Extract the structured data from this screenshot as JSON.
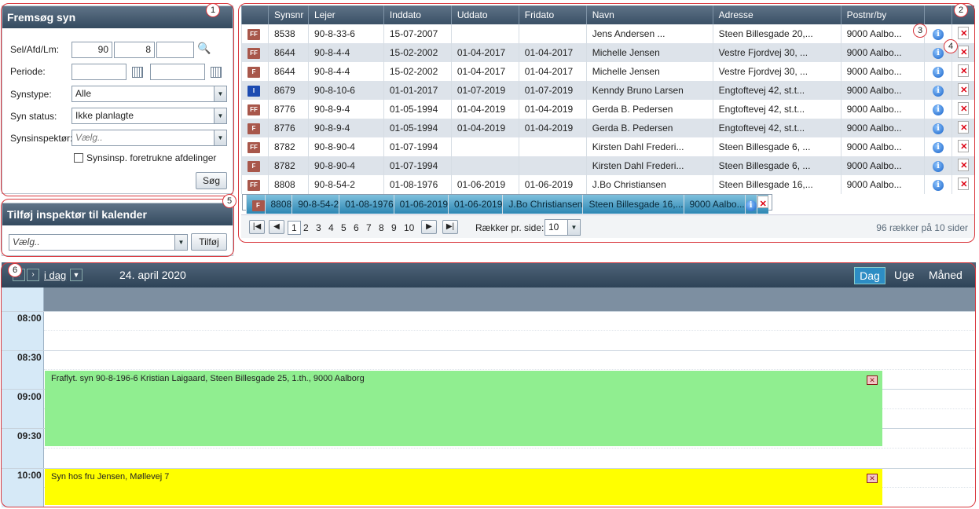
{
  "search": {
    "title": "Fremsøg syn",
    "sel_label": "Sel/Afd/Lm:",
    "sel_value": "90",
    "afd_value": "8",
    "lm_value": "",
    "periode_label": "Periode:",
    "synstype_label": "Synstype:",
    "synstype_value": "Alle",
    "status_label": "Syn status:",
    "status_value": "Ikke planlagte",
    "inspektor_label": "Synsinspektør:",
    "inspektor_placeholder": "Vælg..",
    "checkbox_label": "Synsinsp. foretrukne afdelinger",
    "search_button": "Søg"
  },
  "add": {
    "title": "Tilføj inspektør til kalender",
    "placeholder": "Vælg..",
    "button": "Tilføj"
  },
  "grid": {
    "columns": [
      "",
      "Synsnr",
      "Lejer",
      "Inddato",
      "Uddato",
      "Fridato",
      "Navn",
      "Adresse",
      "Postnr/by",
      "",
      ""
    ],
    "rows": [
      {
        "tag": "FF",
        "synsnr": "8538",
        "lejer": "90-8-33-6",
        "inddato": "15-07-2007",
        "uddato": "",
        "fridato": "",
        "navn": "Jens Andersen ...",
        "adresse": "Steen Billesgade 20,...",
        "postnr": "9000 Aalbo..."
      },
      {
        "tag": "FF",
        "synsnr": "8644",
        "lejer": "90-8-4-4",
        "inddato": "15-02-2002",
        "uddato": "01-04-2017",
        "fridato": "01-04-2017",
        "navn": "Michelle Jensen",
        "adresse": "Vestre Fjordvej 30, ...",
        "postnr": "9000 Aalbo..."
      },
      {
        "tag": "F",
        "synsnr": "8644",
        "lejer": "90-8-4-4",
        "inddato": "15-02-2002",
        "uddato": "01-04-2017",
        "fridato": "01-04-2017",
        "navn": "Michelle Jensen",
        "adresse": "Vestre Fjordvej 30, ...",
        "postnr": "9000 Aalbo..."
      },
      {
        "tag": "I",
        "synsnr": "8679",
        "lejer": "90-8-10-6",
        "inddato": "01-01-2017",
        "uddato": "01-07-2019",
        "fridato": "01-07-2019",
        "navn": "Kenndy Bruno Larsen",
        "adresse": "Engtoftevej 42, st.t...",
        "postnr": "9000 Aalbo..."
      },
      {
        "tag": "FF",
        "synsnr": "8776",
        "lejer": "90-8-9-4",
        "inddato": "01-05-1994",
        "uddato": "01-04-2019",
        "fridato": "01-04-2019",
        "navn": "Gerda B. Pedersen",
        "adresse": "Engtoftevej 42, st.t...",
        "postnr": "9000 Aalbo..."
      },
      {
        "tag": "F",
        "synsnr": "8776",
        "lejer": "90-8-9-4",
        "inddato": "01-05-1994",
        "uddato": "01-04-2019",
        "fridato": "01-04-2019",
        "navn": "Gerda B. Pedersen",
        "adresse": "Engtoftevej 42, st.t...",
        "postnr": "9000 Aalbo..."
      },
      {
        "tag": "FF",
        "synsnr": "8782",
        "lejer": "90-8-90-4",
        "inddato": "01-07-1994",
        "uddato": "",
        "fridato": "",
        "navn": "Kirsten Dahl Frederi...",
        "adresse": "Steen Billesgade 6, ...",
        "postnr": "9000 Aalbo..."
      },
      {
        "tag": "F",
        "synsnr": "8782",
        "lejer": "90-8-90-4",
        "inddato": "01-07-1994",
        "uddato": "",
        "fridato": "",
        "navn": "Kirsten Dahl Frederi...",
        "adresse": "Steen Billesgade 6, ...",
        "postnr": "9000 Aalbo..."
      },
      {
        "tag": "FF",
        "synsnr": "8808",
        "lejer": "90-8-54-2",
        "inddato": "01-08-1976",
        "uddato": "01-06-2019",
        "fridato": "01-06-2019",
        "navn": "J.Bo Christiansen",
        "adresse": "Steen Billesgade 16,...",
        "postnr": "9000 Aalbo..."
      },
      {
        "tag": "F",
        "synsnr": "8808",
        "lejer": "90-8-54-2",
        "inddato": "01-08-1976",
        "uddato": "01-06-2019",
        "fridato": "01-06-2019",
        "navn": "J.Bo Christiansen",
        "adresse": "Steen Billesgade 16,...",
        "postnr": "9000 Aalbo..."
      }
    ],
    "selected_row": 9,
    "pages": [
      "1",
      "2",
      "3",
      "4",
      "5",
      "6",
      "7",
      "8",
      "9",
      "10"
    ],
    "current_page": "1",
    "rows_per_page_label": "Rækker pr. side:",
    "rows_per_page": "10",
    "summary": "96 rækker på 10 sider"
  },
  "calendar": {
    "today": "i dag",
    "date": "24. april 2020",
    "views": [
      "Dag",
      "Uge",
      "Måned"
    ],
    "active_view": "Dag",
    "times": [
      "08:00",
      "08:30",
      "09:00",
      "09:30",
      "10:00"
    ],
    "appointments": [
      {
        "text": "Fraflyt. syn 90-8-196-6 Kristian Laigaard, Steen Billesgade 25, 1.th., 9000 Aalborg",
        "color": "#90ee90"
      },
      {
        "text": "Syn hos fru Jensen, Møllevej 7",
        "color": "#ffff00"
      }
    ]
  },
  "callouts": [
    "1",
    "2",
    "3",
    "4",
    "5",
    "6"
  ]
}
